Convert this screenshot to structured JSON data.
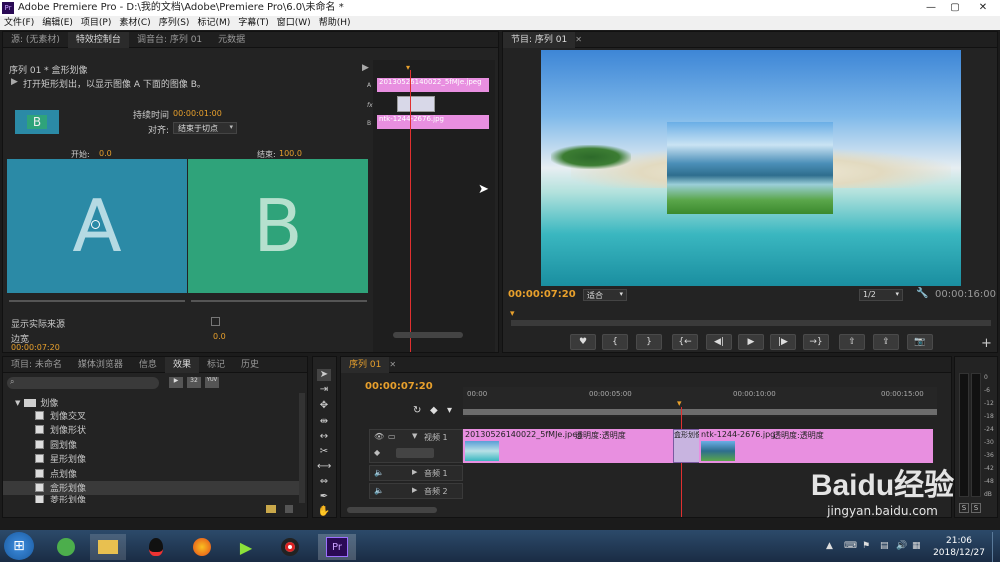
{
  "window": {
    "title": "Adobe Premiere Pro - D:\\我的文档\\Adobe\\Premiere Pro\\6.0\\未命名 *"
  },
  "menu": [
    "文件(F)",
    "编辑(E)",
    "项目(P)",
    "素材(C)",
    "序列(S)",
    "标记(M)",
    "字幕(T)",
    "窗口(W)",
    "帮助(H)"
  ],
  "source_panel": {
    "tabs": [
      "源: (无素材)",
      "特效控制台",
      "调音台: 序列 01",
      "元数据"
    ],
    "header": "序列 01 * 盒形划像",
    "description": "打开矩形划出，以显示图像 A 下面的图像 B。",
    "thumb_label": "B",
    "duration_label": "持续时间",
    "duration_value": "00:00:01:00",
    "align_label": "对齐:",
    "align_value": "结束于切点",
    "start_label": "开始:",
    "start_value": "0.0",
    "end_label": "结束:",
    "end_value": "100.0",
    "a_label": "A",
    "b_label": "B",
    "show_source_label": "显示实际来源",
    "border_label": "边宽",
    "border_value": "0.0",
    "timecode": "00:00:07:20",
    "mini_clip_a": "20130526140022_5fMJe.jpeg",
    "mini_clip_b": "ntk-1244-2676.jpg",
    "mini_track_a": "A",
    "mini_track_b": "B",
    "mini_fx": "fx"
  },
  "program_panel": {
    "tab": "节目: 序列 01",
    "timecode": "00:00:07:20",
    "fit_value": "适合",
    "zoom_value": "1/2",
    "duration": "00:00:16:00",
    "controls": [
      "mark-icon",
      "in-point-icon",
      "out-point-icon",
      "go-to-in-icon",
      "step-back-icon",
      "play-icon",
      "step-forward-icon",
      "go-to-out-icon",
      "lift-icon",
      "extract-icon",
      "export-frame-icon"
    ]
  },
  "project_panel": {
    "tabs": [
      "项目: 未命名",
      "媒体浏览器",
      "信息",
      "效果",
      "标记",
      "历史"
    ],
    "folder": "划像",
    "items": [
      "划像交叉",
      "划像形状",
      "圆划像",
      "星形划像",
      "点划像",
      "盒形划像",
      "菱形划像"
    ]
  },
  "timeline": {
    "tab": "序列 01",
    "timecode": "00:00:07:20",
    "ruler": [
      "00:00",
      "00:00:05:00",
      "00:00:10:00",
      "00:00:15:00"
    ],
    "video_track": "视频 1",
    "audio_tracks": [
      "音频 1",
      "音频 2"
    ],
    "clip1": "20130526140022_5fMJe.jpeg",
    "clip1_opacity": "透明度:透明度",
    "transition": "盒形划像",
    "clip2": "ntk-1244-2676.jpg",
    "clip2_opacity": "透明度:透明度"
  },
  "audio_meter": {
    "labels": [
      "0",
      "-6",
      "-12",
      "-18",
      "-24",
      "-30",
      "-36",
      "-42",
      "-48",
      "dB"
    ],
    "solo": [
      "S",
      "S"
    ]
  },
  "watermark": {
    "text": "Baidu经验",
    "url": "jingyan.baidu.com"
  },
  "taskbar": {
    "clock_time": "21:06",
    "clock_date": "2018/12/27",
    "pr_label": "Pr"
  },
  "colors": {
    "accent_blue": "#5aa2e6",
    "timecode_orange": "#e8a02c",
    "clip_pink": "#e88fe0",
    "a_blue": "#2b8aa6",
    "b_green": "#2fa37a",
    "playhead_red": "#e03030"
  }
}
